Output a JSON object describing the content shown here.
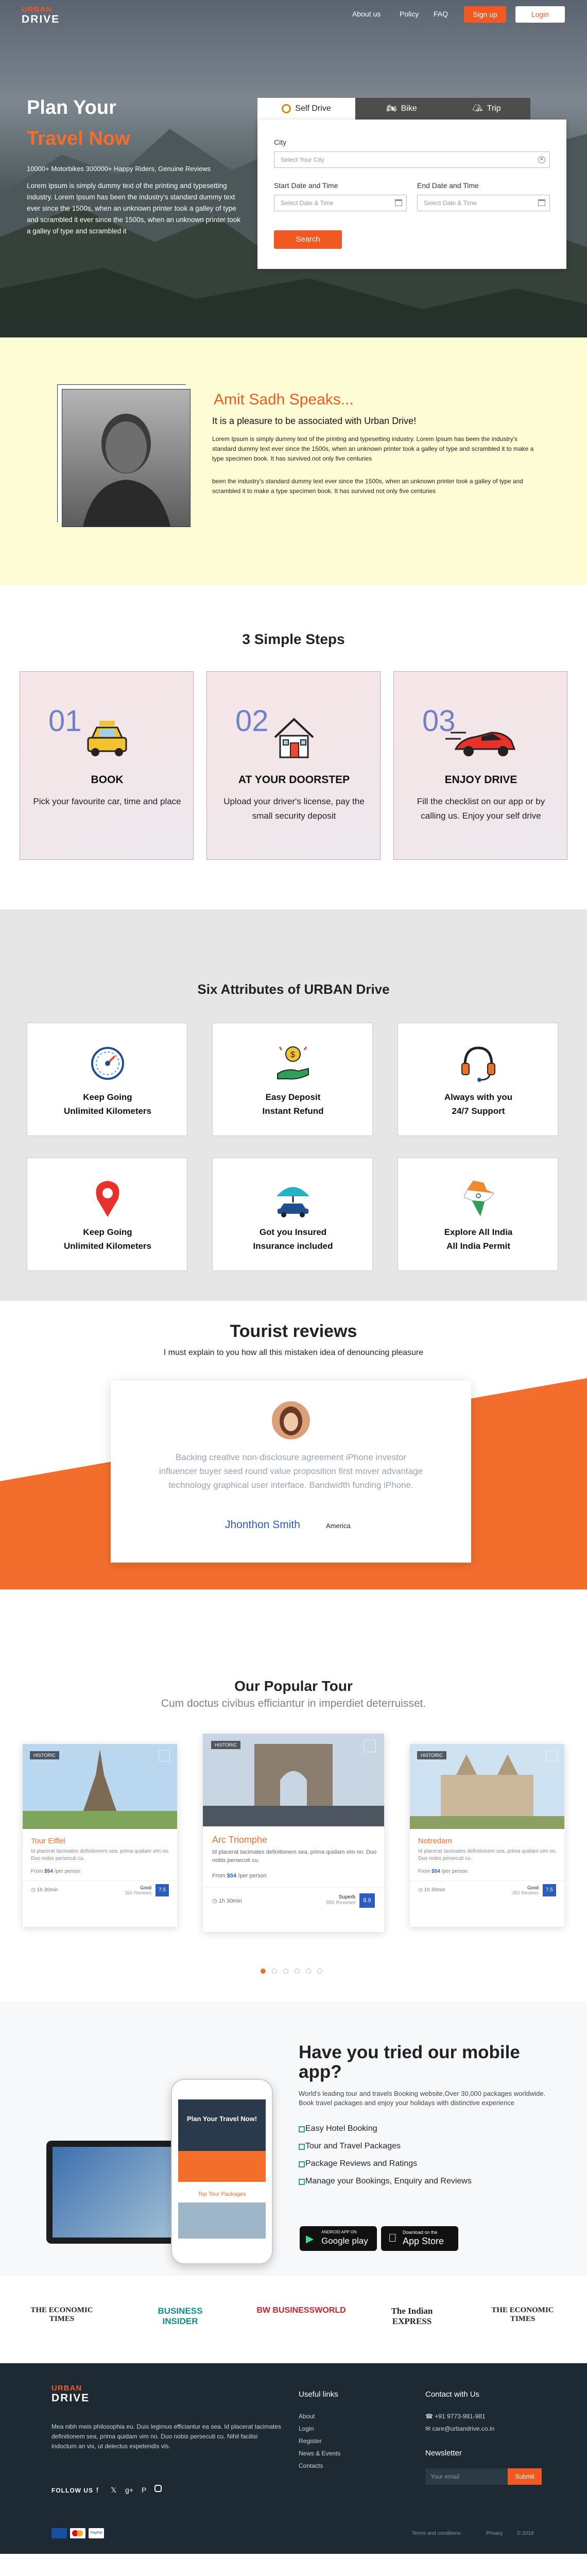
{
  "nav": {
    "logo_top": "URBAN",
    "logo_bottom": "DRIVE",
    "about": "About us",
    "policy": "Policy",
    "faq": "FAQ",
    "signup": "Sign up",
    "login": "Login"
  },
  "hero": {
    "title1": "Plan Your",
    "title2": "Travel Now",
    "stats": "10000+ Motorbikes   300000+ Happy Riders,  Genuine Reviews",
    "description": "Lorem Ipsum is simply dummy text of the printing and typesetting industry. Lorem Ipsum has been the industry's standard dummy text ever since the 1500s, when an unknown printer took a galley of type and scrambled it ever since the 1500s, when an unknown printer took a galley of type and scrambled it"
  },
  "booking": {
    "tabs": [
      "Self Drive",
      "Bike",
      "Trip"
    ],
    "city_label": "City",
    "city_placeholder": "Select Your City",
    "start_label": "Start Date and Time",
    "start_placeholder": "Select Date & Time",
    "end_label": "End Date and Time",
    "end_placeholder": "Select Date & Time",
    "search": "Search"
  },
  "speaks": {
    "title": "Amit Sadh Speaks...",
    "subtitle": "It is a pleasure to be associated with Urban Drive!",
    "p1": "Lorem Ipsum is simply dummy text of the printing and typesetting industry. Lorem Ipsum has been the industry's standard dummy text ever since the 1500s, when an unknown printer took a galley of type and scrambled it to make a type specimen book. It has survived not only five centuries",
    "p2": "been the industry's standard dummy text ever since the 1500s, when an unknown printer took a galley of type and scrambled it to make a type specimen book. It has survived not only five centuries"
  },
  "steps": {
    "title": "3 Simple Steps",
    "items": [
      {
        "num": "01",
        "title": "BOOK",
        "desc": "Pick your favourite car, time and place",
        "icon": "taxi-icon"
      },
      {
        "num": "02",
        "title": "AT YOUR DOORSTEP",
        "desc": "Upload your driver's license, pay the small security deposit",
        "icon": "house-icon"
      },
      {
        "num": "03",
        "title": "ENJOY DRIVE",
        "desc": "Fill the checklist on our app or by calling us. Enjoy your self drive",
        "icon": "sports-car-icon"
      }
    ]
  },
  "attributes": {
    "title": "Six Attributes of URBAN Drive",
    "items": [
      {
        "line1": "Keep Going",
        "line2": "Unlimited Kilometers",
        "icon": "speedometer-icon"
      },
      {
        "line1": "Easy Deposit",
        "line2": "Instant Refund",
        "icon": "money-hand-icon"
      },
      {
        "line1": "Always with you",
        "line2": "24/7 Support",
        "icon": "headset-icon"
      },
      {
        "line1": "Keep Going",
        "line2": "Unlimited Kilometers",
        "icon": "map-pin-icon"
      },
      {
        "line1": "Got you Insured",
        "line2": "Insurance included",
        "icon": "umbrella-car-icon"
      },
      {
        "line1": "Explore All India",
        "line2": "All India Permit",
        "icon": "india-map-icon"
      }
    ]
  },
  "reviews": {
    "title": "Tourist reviews",
    "subtitle": "I must explain to you how all this mistaken idea of denouncing pleasure",
    "quote": "Backing creative non-disclosure agreement iPhone investor influencer buyer seed round value proposition first mover advantage technology graphical user interface. Bandwidth funding iPhone.",
    "name": "Jhonthon Smith",
    "location": "America"
  },
  "tours": {
    "title": "Our Popular Tour",
    "subtitle": "Cum doctus civibus efficiantur in imperdiet deterruisset.",
    "items": [
      {
        "badge": "HISTORIC",
        "name": "Tour Eiffel",
        "desc": "Id placerat tacimates definitionem sea, prima quidam vim no. Duo nobis persecuti cu.",
        "from": "From",
        "price": "$54",
        "per": "/per person",
        "duration": "1h 30min",
        "rating_label": "Good",
        "reviews": "350 Reviews",
        "score": "7.5"
      },
      {
        "badge": "HISTORIC",
        "name": "Arc Triomphe",
        "desc": "Id placerat tacimates definitionem sea, prima quidam vim no. Duo nobis persecuti cu.",
        "from": "From",
        "price": "$54",
        "per": "/per person",
        "duration": "1h 30min",
        "rating_label": "Superb",
        "reviews": "350 Reviews",
        "score": "8.9"
      },
      {
        "badge": "HISTORIC",
        "name": "Notredam",
        "desc": "Id placerat tacimates definitionem sea, prima quidam vim no. Duo nobis persecuti cu.",
        "from": "From",
        "price": "$54",
        "per": "/per person",
        "duration": "1h 30min",
        "rating_label": "Good",
        "reviews": "350 Reviews",
        "score": "7.5"
      }
    ]
  },
  "app": {
    "title": "Have you tried our mobile app?",
    "desc": "World's leading tour and travels Booking website,Over 30,000 packages worldwide. Book travel packages and enjoy your holidays with distinctive experience",
    "features": [
      "Easy Hotel Booking",
      "Tour and Travel Packages",
      "Package Reviews and Ratings",
      "Manage your Bookings, Enquiry and Reviews"
    ],
    "gp_top": "ANDROID APP ON",
    "gp_bottom": "Google play",
    "as_top": "Download on the",
    "as_bottom": "App Store",
    "phone_title": "Plan Your Travel Now!",
    "phone_section": "Top Tour Packages"
  },
  "press": [
    "THE ECONOMIC TIMES",
    "BUSINESS INSIDER",
    "BW BUSINESSWORLD",
    "The Indian EXPRESS",
    "THE ECONOMIC TIMES"
  ],
  "footer": {
    "about": "Mea nibh meis philosophia eu. Duis legimus efficiantur ea sea. Id placerat tacimates definitionem sea, prima quidam vim no. Duo nobis persecuti cu. Nihil facilisi indoctum an vix, ut delectus expetendis vis.",
    "follow": "FOLLOW US",
    "useful_title": "Useful links",
    "useful_links": [
      "About",
      "Login",
      "Register",
      "News & Events",
      "Contacts"
    ],
    "contact_title": "Contact with Us",
    "phone": "+91 9773-981-981",
    "email": "care@urbandrive.co.in",
    "newsletter_title": "Newsletter",
    "newsletter_placeholder": "Your email",
    "submit": "Submit",
    "terms": "Terms and conditions",
    "privacy": "Privacy",
    "copy": "© 2018"
  },
  "colors": {
    "accent": "#f05a22",
    "heading_blue": "#2a5dbf",
    "footer_bg": "#1d2a33"
  }
}
